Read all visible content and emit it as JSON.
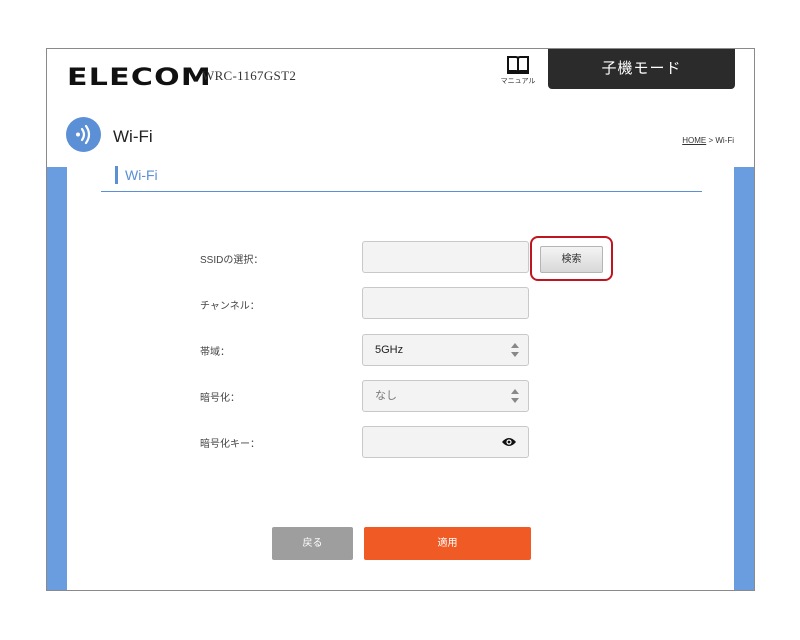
{
  "header": {
    "logo": "ELECOM",
    "model": "WRC-1167GST2",
    "manual_label": "マニュアル",
    "mode_button": "子機モード"
  },
  "page": {
    "title": "Wi-Fi",
    "breadcrumb_home": "HOME",
    "breadcrumb_sep": " > ",
    "breadcrumb_current": "Wi-Fi",
    "section_title": "Wi-Fi"
  },
  "form": {
    "ssid_label": "SSIDの選択：",
    "ssid_value": "",
    "search_button": "検索",
    "channel_label": "チャンネル：",
    "channel_value": "",
    "band_label": "帯域：",
    "band_value": "5GHz",
    "encryption_label": "暗号化：",
    "encryption_value": "なし",
    "key_label": "暗号化キー：",
    "key_value": ""
  },
  "actions": {
    "back": "戻る",
    "apply": "適用"
  },
  "colors": {
    "accent_blue": "#5b8fd6",
    "side_blue": "#6a9ce0",
    "apply_orange": "#f05a24",
    "back_gray": "#9e9e9e",
    "highlight_red": "#c0151f",
    "mode_button_dark": "#2b2b2b"
  },
  "icons": {
    "manual": "book-icon",
    "wifi": "wifi-icon",
    "spinner": "up-down-arrows-icon",
    "eye": "eye-icon"
  }
}
